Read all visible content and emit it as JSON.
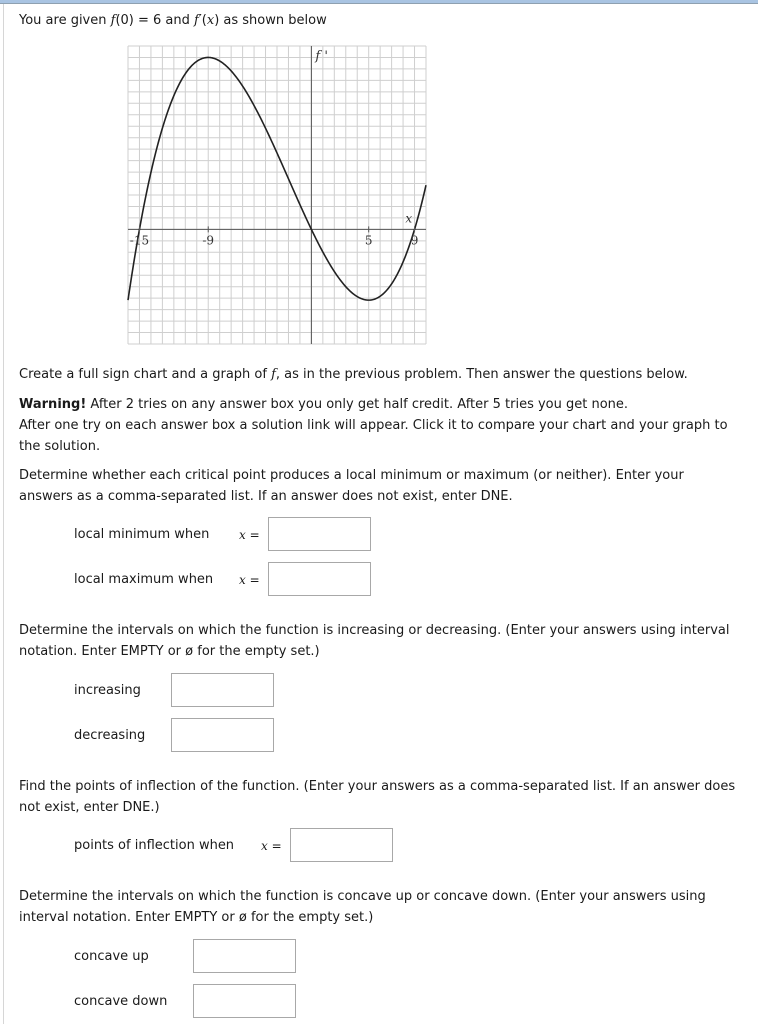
{
  "intro": {
    "prefix": "You are given ",
    "f0_expr": "f",
    "f0_rest": "(0) = 6 and ",
    "fprime_expr": "f",
    "fprime_mid": "′(",
    "fprime_x": "x",
    "fprime_end": ") as shown below"
  },
  "chart_data": {
    "type": "line",
    "title": "",
    "series": [
      {
        "name": "f'",
        "formula": "f'(x) = k*x*(x+15)*(x-9)",
        "roots": [
          -15,
          0,
          9
        ],
        "local_max": {
          "x": -9,
          "y": 15
        },
        "local_min": {
          "x": 5,
          "y": -6.2
        }
      }
    ],
    "xlabel": "x",
    "ylabel": "f '",
    "xlim": [
      -16,
      10
    ],
    "ylim": [
      -10,
      16
    ],
    "x_tick_labels": [
      {
        "value": -15,
        "label": "-15"
      },
      {
        "value": -9,
        "label": "-9"
      },
      {
        "value": 5,
        "label": "5"
      },
      {
        "value": 9,
        "label": "9"
      }
    ],
    "grid": true,
    "grid_step": 1
  },
  "instructions": {
    "create_prefix": "Create a full sign chart and a graph of ",
    "create_f": "f",
    "create_suffix": ", as in the previous problem. Then answer the questions below.",
    "warning_label": "Warning!",
    "warning_text": " After 2 tries on any answer box you only get half credit. After 5 tries you get none.",
    "solution_text": "After one try on each answer box a solution link will appear. Click it to compare your chart and your graph to the solution."
  },
  "q_extrema": {
    "text": "Determine whether each critical point produces a local minimum or maximum (or neither). Enter your answers as a comma-separated list. If an answer does not exist, enter DNE.",
    "min_label": "local minimum when",
    "max_label": "local maximum when",
    "x_eq": "x",
    "eq": " =",
    "min_value": "",
    "max_value": ""
  },
  "q_monotonic": {
    "text": "Determine the intervals on which the function is increasing or decreasing. (Enter your answers using interval notation. Enter EMPTY or ø for the empty set.)",
    "inc_label": "increasing",
    "dec_label": "decreasing",
    "inc_value": "",
    "dec_value": ""
  },
  "q_inflection": {
    "text": "Find the points of inflection of the function. (Enter your answers as a comma-separated list. If an answer does not exist, enter DNE.)",
    "label": "points of inflection when",
    "x_eq": "x",
    "eq": " =",
    "value": ""
  },
  "q_concavity": {
    "text": "Determine the intervals on which the function is concave up or concave down. (Enter your answers using interval notation. Enter EMPTY or ø for the empty set.)",
    "up_label": "concave up",
    "down_label": "concave down",
    "up_value": "",
    "down_value": ""
  }
}
